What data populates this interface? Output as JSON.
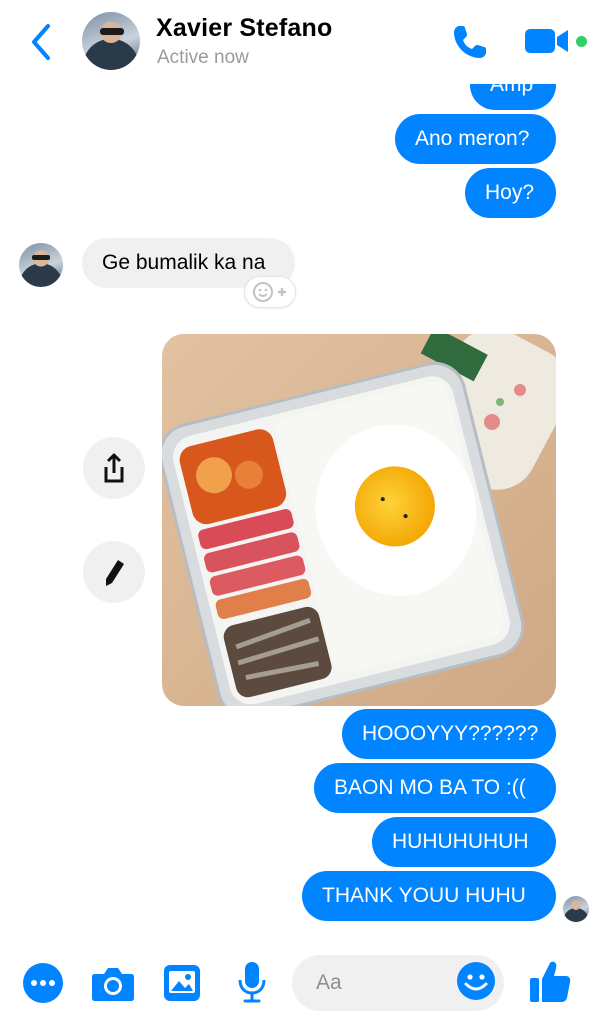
{
  "header": {
    "contact_name": "Xavier Stefano",
    "status": "Active now",
    "icons": [
      "chevron-left-icon",
      "phone-icon",
      "video-camera-icon"
    ],
    "active_color": "#2fd06a"
  },
  "messages": {
    "m0": "Amp",
    "m1": "Ano meron?",
    "m2": "Hoy?",
    "m3": "Ge bumalik ka na",
    "m4": "HOOOYYY??????",
    "m5": "BAON MO BA TO :((",
    "m6": "HUHUHUHUH",
    "m7": "THANK YOUU HUHU"
  },
  "photo_actions": [
    "share-icon",
    "edit-pencil-icon"
  ],
  "composer": {
    "placeholder": "Aa",
    "icons": [
      "more-icon",
      "camera-icon",
      "gallery-icon",
      "microphone-icon",
      "emoji-icon",
      "thumbs-up-icon"
    ]
  },
  "colors": {
    "accent": "#0084ff",
    "incoming_bubble": "#f1f0f0",
    "outgoing_text": "#ffffff"
  }
}
